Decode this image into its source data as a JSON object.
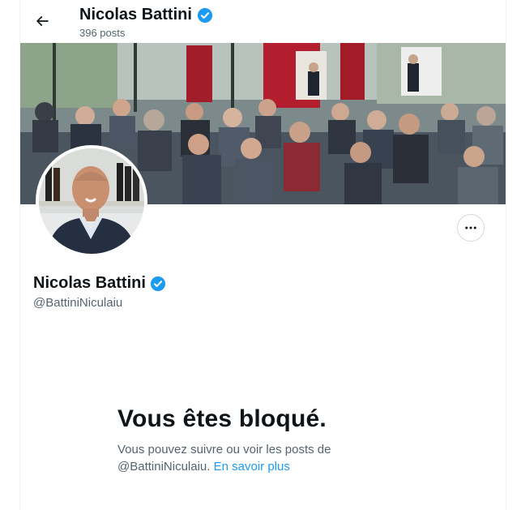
{
  "header": {
    "back_icon": "arrow-left-icon",
    "name": "Nicolas Battini",
    "verified_icon": "verified-badge-icon",
    "posts_count": "396 posts"
  },
  "banner": {
    "description_icon": "audience-photo"
  },
  "profile": {
    "name": "Nicolas Battini",
    "handle": "@BattiniNiculaiu",
    "more_icon": "more-horizontal-icon"
  },
  "blocked": {
    "title": "Vous êtes bloqué.",
    "text": "Vous pouvez suivre ou voir les posts de @BattiniNiculaiu.",
    "link": "En savoir plus"
  },
  "colors": {
    "accent": "#1d9bf0",
    "text_primary": "#0f1419",
    "text_secondary": "#536471"
  }
}
